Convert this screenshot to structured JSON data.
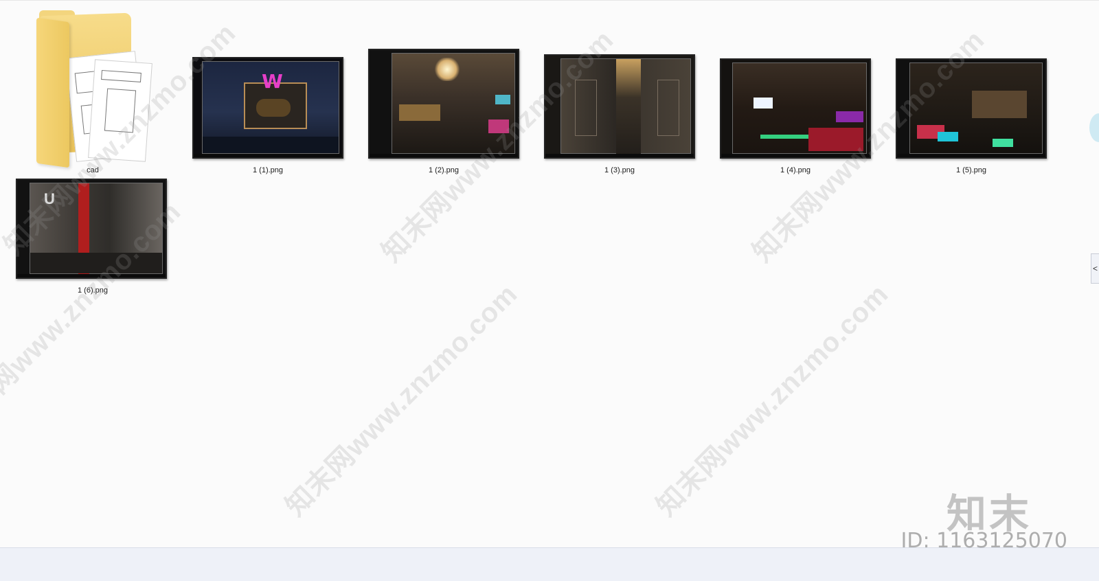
{
  "files": [
    {
      "name": "cad",
      "type": "folder",
      "icon": "folder-icon"
    },
    {
      "name": "1 (1).png",
      "type": "image",
      "palette": [
        "#1b2744",
        "#e63ec8",
        "#b98e56"
      ]
    },
    {
      "name": "1 (2).png",
      "type": "image",
      "palette": [
        "#2d2520",
        "#c89a5a",
        "#4fb6c8"
      ]
    },
    {
      "name": "1 (3).png",
      "type": "image",
      "palette": [
        "#2a2622",
        "#6b6258",
        "#c8a060"
      ]
    },
    {
      "name": "1 (4).png",
      "type": "image",
      "palette": [
        "#231a14",
        "#9b1a2a",
        "#c89a5a"
      ]
    },
    {
      "name": "1 (5).png",
      "type": "image",
      "palette": [
        "#1e1914",
        "#20c4d8",
        "#c8304a"
      ]
    },
    {
      "name": "1 (6).png",
      "type": "image",
      "palette": [
        "#2f2d2a",
        "#8a8580",
        "#b01e1e"
      ]
    }
  ],
  "watermark": {
    "text": "知末网www.znzmo.com",
    "logo": "知末",
    "id_label": "ID: 1163125070"
  },
  "side_panel": {
    "toggle_glyph": "<"
  }
}
